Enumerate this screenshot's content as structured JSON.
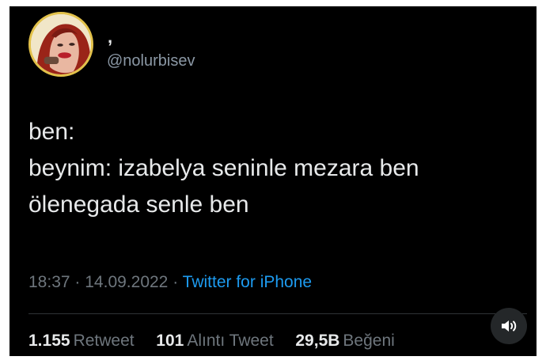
{
  "user": {
    "display_name": ",",
    "handle": "@nolurbisev"
  },
  "tweet": {
    "lines": [
      "ben:",
      "beynim: izabelya seninle mezara ben",
      "ölenegada senle ben"
    ],
    "time": "18:37",
    "separator": "·",
    "date": "14.09.2022",
    "source": "Twitter for iPhone"
  },
  "stats": {
    "retweets_count": "1.155",
    "retweets_label": "Retweet",
    "quotes_count": "101",
    "quotes_label": "Alıntı Tweet",
    "likes_count": "29,5B",
    "likes_label": "Beğeni"
  },
  "icons": {
    "sound": "speaker-icon"
  },
  "colors": {
    "background": "#000000",
    "text": "#e7e9ea",
    "muted": "#6e767d",
    "link": "#1d9bf0",
    "avatar_ring": "#e2c14a"
  }
}
